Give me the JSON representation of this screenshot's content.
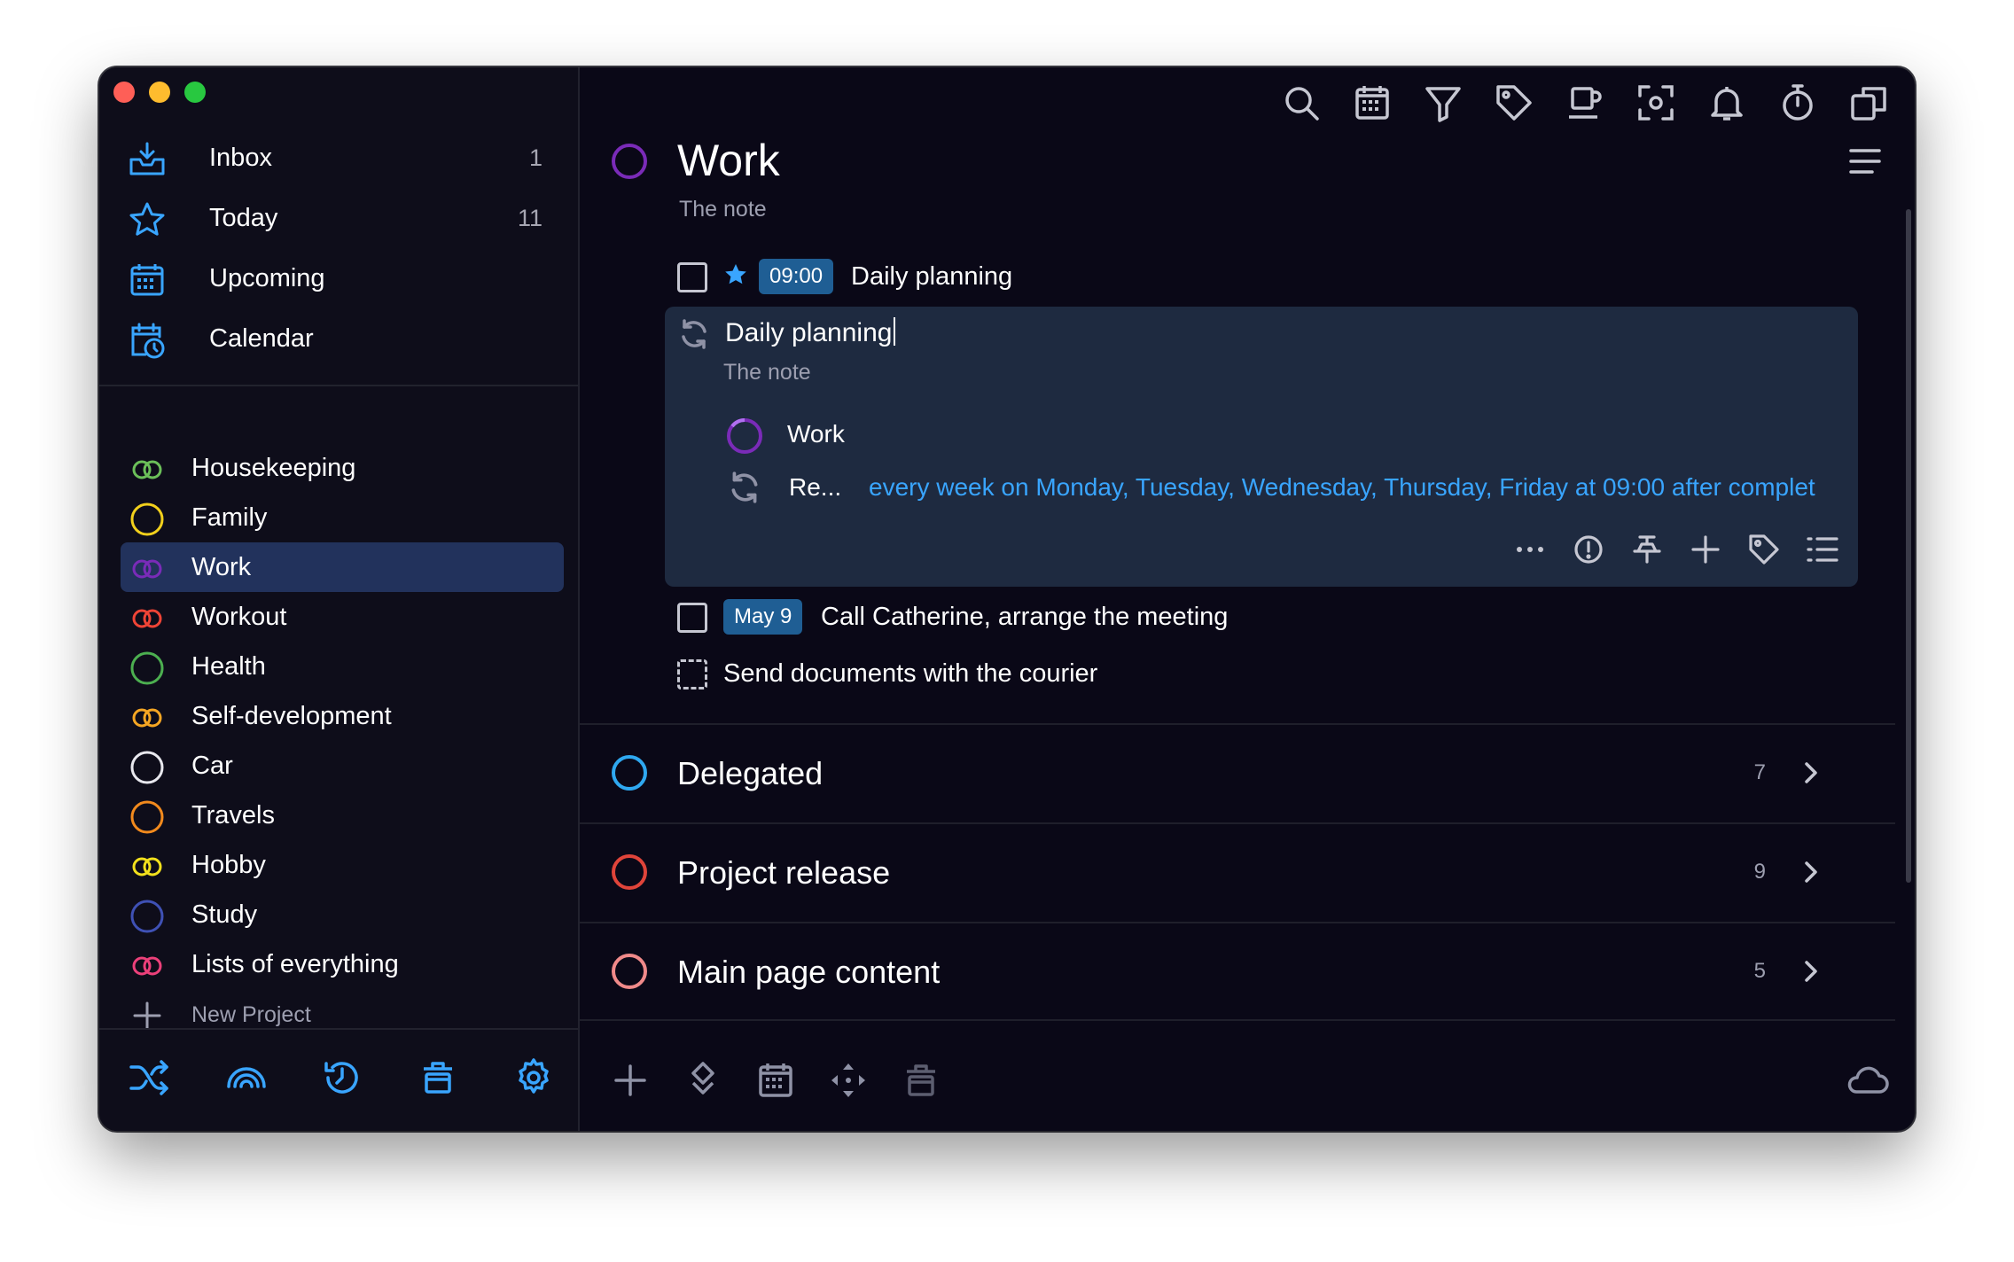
{
  "sidebar": {
    "nav": [
      {
        "label": "Inbox",
        "count": "1",
        "icon": "inbox-icon"
      },
      {
        "label": "Today",
        "count": "11",
        "icon": "star-icon"
      },
      {
        "label": "Upcoming",
        "count": "",
        "icon": "calendar-grid-icon"
      },
      {
        "label": "Calendar",
        "count": "",
        "icon": "calendar-clock-icon"
      }
    ],
    "projects": [
      {
        "label": "Housekeeping",
        "color": "#6bbf59",
        "icon": "double-circle-icon"
      },
      {
        "label": "Family",
        "color": "#f2d01c",
        "icon": "circle-icon"
      },
      {
        "label": "Work",
        "color": "#7a2bb8",
        "icon": "double-circle-icon",
        "selected": true
      },
      {
        "label": "Workout",
        "color": "#ef4436",
        "icon": "double-circle-icon"
      },
      {
        "label": "Health",
        "color": "#4caf50",
        "icon": "circle-icon"
      },
      {
        "label": "Self-development",
        "color": "#f5a623",
        "icon": "double-circle-icon"
      },
      {
        "label": "Car",
        "color": "#e8e8ee",
        "icon": "circle-icon"
      },
      {
        "label": "Travels",
        "color": "#f28a1d",
        "icon": "circle-icon"
      },
      {
        "label": "Hobby",
        "color": "#f2e01c",
        "icon": "double-circle-icon"
      },
      {
        "label": "Study",
        "color": "#3f51b5",
        "icon": "circle-icon"
      },
      {
        "label": "Lists of everything",
        "color": "#ec407a",
        "icon": "double-circle-icon"
      }
    ],
    "new_project": "New Project",
    "footer_icons": [
      "shuffle-icon",
      "rainbow-icon",
      "history-icon",
      "trash-icon",
      "settings-icon"
    ]
  },
  "toolbar": {
    "icons": [
      "search-icon",
      "calendar-icon",
      "filter-icon",
      "tag-icon",
      "coffee-icon",
      "focus-icon",
      "bell-icon",
      "timer-icon",
      "copy-icon"
    ]
  },
  "project": {
    "title": "Work",
    "note": "The note",
    "color": "#7a2bb8"
  },
  "tasks": [
    {
      "time_badge": "09:00",
      "text": "Daily planning",
      "starred": true
    },
    {
      "date_badge": "May 9",
      "text": "Call Catherine, arrange the meeting"
    },
    {
      "text": "Send documents with the courier",
      "dashed": true
    }
  ],
  "editor": {
    "title": "Daily planning",
    "note": "The note",
    "project_label": "Work",
    "repeat_label": "Re...",
    "repeat_text": "every week on Monday, Tuesday, Wednesday, Thursday, Friday at 09:00 after complet",
    "tool_icons": [
      "more-icon",
      "priority-icon",
      "pin-icon",
      "add-icon",
      "tag-icon",
      "checklist-icon"
    ]
  },
  "groups": [
    {
      "title": "Delegated",
      "count": "7",
      "color": "#2fa8f0"
    },
    {
      "title": "Project release",
      "count": "9",
      "color": "#e0443a"
    },
    {
      "title": "Main page content",
      "count": "5",
      "color": "#f08a8a"
    }
  ],
  "footer": {
    "icons": [
      "add-icon",
      "move-icon",
      "calendar-icon",
      "arrows-icon",
      "trash-icon"
    ],
    "cloud_icon": "cloud-icon"
  },
  "colors": {
    "accent": "#39a5ff",
    "badge": "#1f5e94",
    "selected": "#22325c",
    "background": "#0a0817"
  }
}
